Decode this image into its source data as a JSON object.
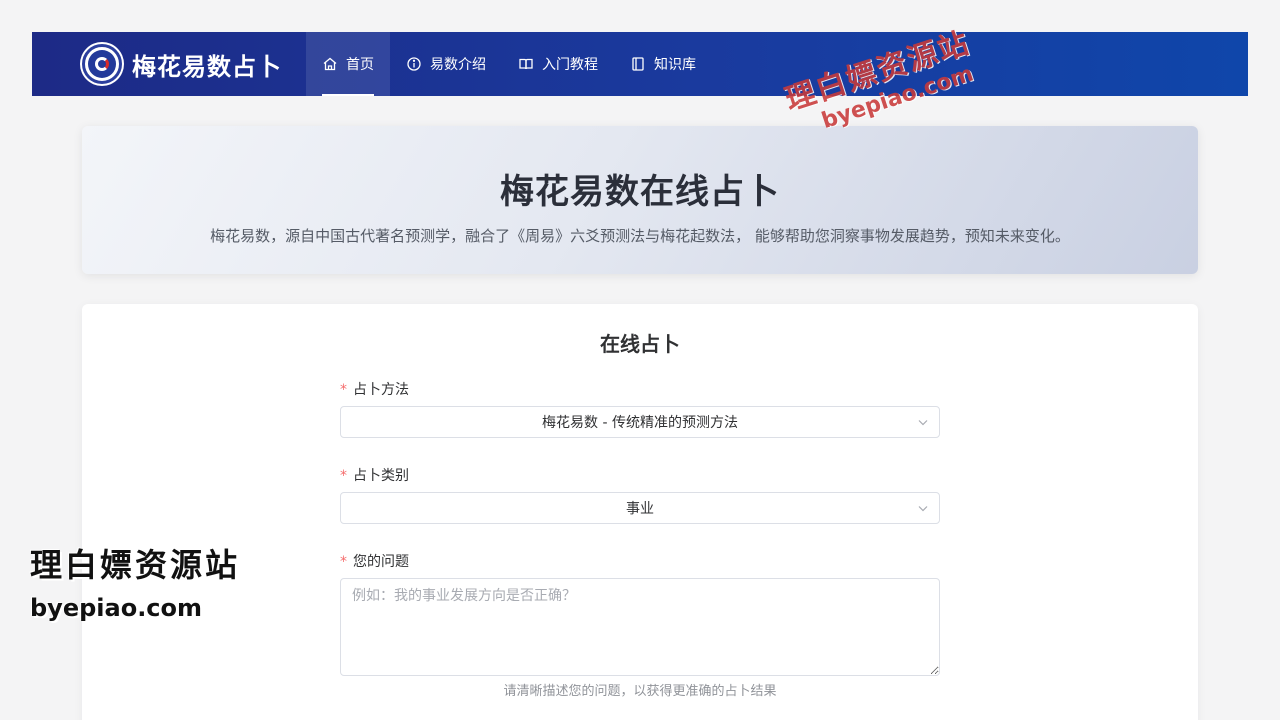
{
  "header": {
    "brand": "梅花易数占卜",
    "nav": [
      {
        "label": "首页",
        "icon": "home-icon",
        "active": true
      },
      {
        "label": "易数介绍",
        "icon": "info-circle-icon",
        "active": false
      },
      {
        "label": "入门教程",
        "icon": "open-book-icon",
        "active": false
      },
      {
        "label": "知识库",
        "icon": "notebook-icon",
        "active": false
      }
    ]
  },
  "hero": {
    "title": "梅花易数在线占卜",
    "description": "梅花易数，源自中国古代著名预测学，融合了《周易》六爻预测法与梅花起数法， 能够帮助您洞察事物发展趋势，预知未来变化。"
  },
  "form": {
    "title": "在线占卜",
    "method": {
      "label": "占卜方法",
      "value": "梅花易数 - 传统精准的预测方法"
    },
    "category": {
      "label": "占卜类别",
      "value": "事业"
    },
    "question": {
      "label": "您的问题",
      "placeholder": "例如：我的事业发展方向是否正确？",
      "hint": "请清晰描述您的问题，以获得更准确的占卜结果"
    },
    "required_mark": "*"
  },
  "watermarks": {
    "top_line1": "理白嫖资源站",
    "top_line2": "byepiao.com",
    "left_line1": "理白嫖资源站",
    "left_line2": "byepiao.com"
  },
  "colors": {
    "nav_start": "#1d2a86",
    "nav_end": "#0f46aa",
    "required": "#f56c6c",
    "watermark_red": "#c93a3a"
  }
}
